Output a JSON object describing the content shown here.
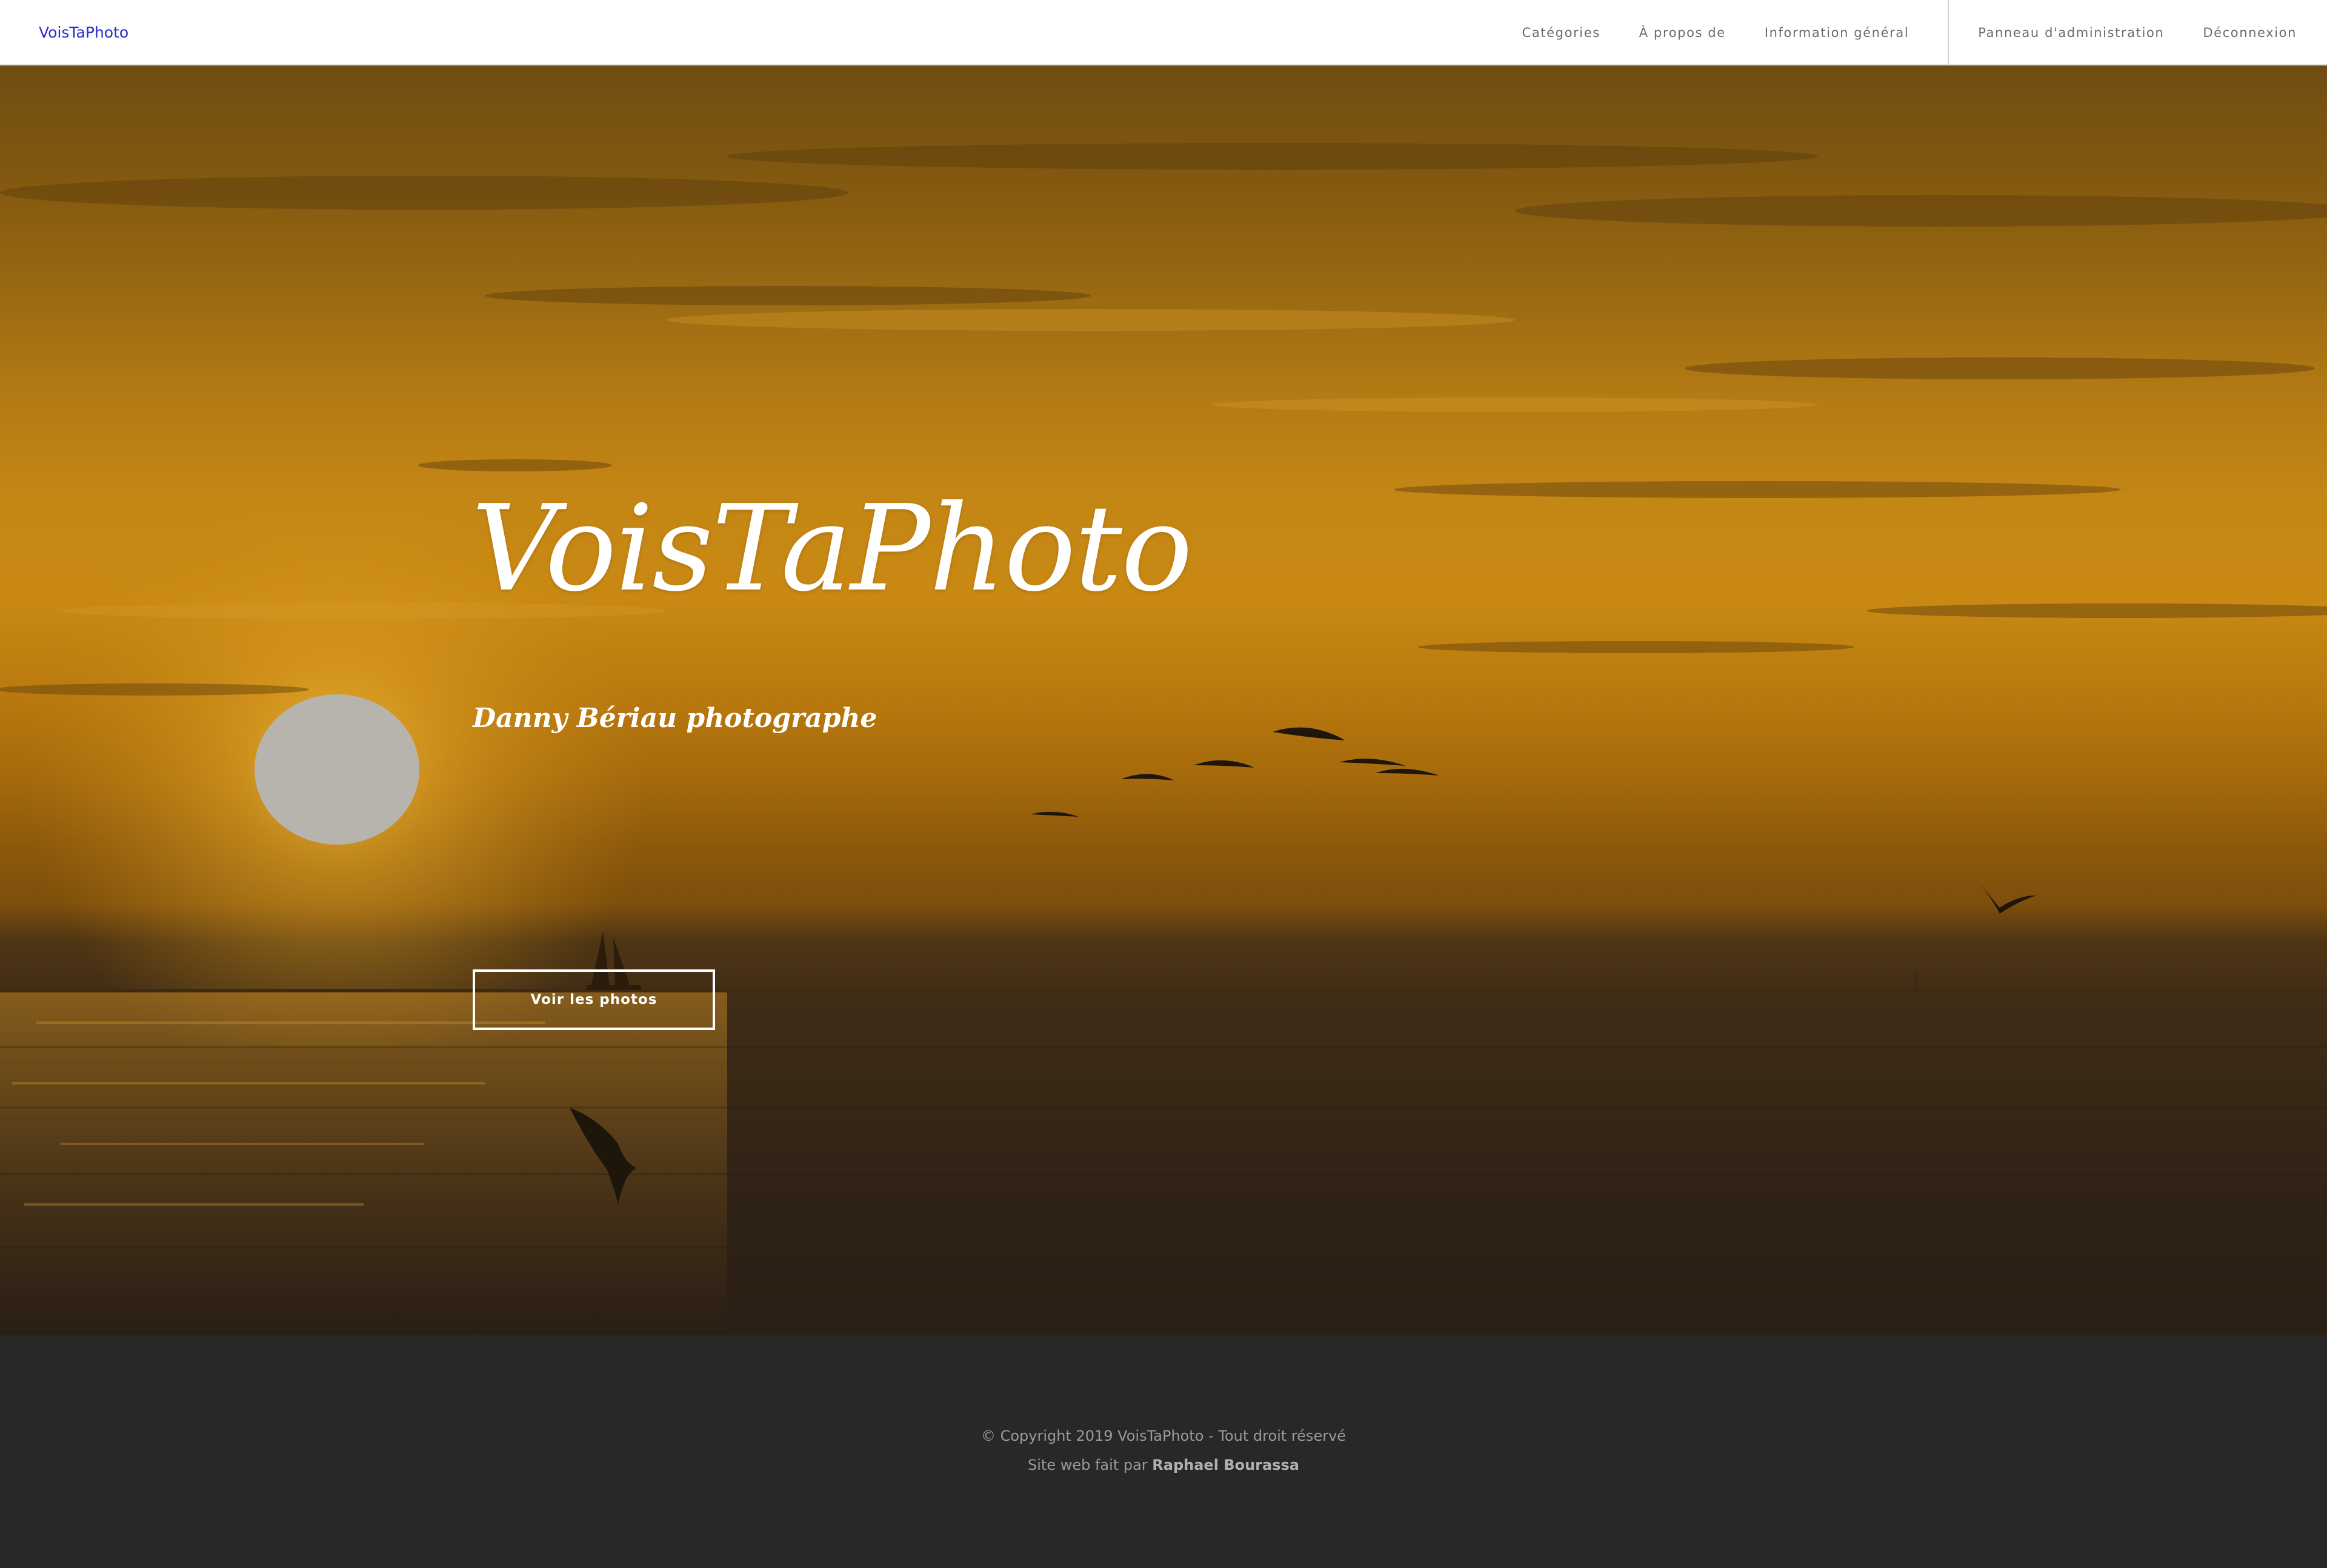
{
  "navbar": {
    "brand": "VoisTaPhoto",
    "links": [
      "Catégories",
      "À propos de",
      "Information général"
    ],
    "account_links": [
      "Panneau d'administration",
      "Déconnexion"
    ]
  },
  "hero": {
    "title": "VoisTaPhoto",
    "subtitle": "Danny Bériau photographe",
    "button_label": "Voir les photos",
    "image_description_icon": "sunset-sea-image"
  },
  "footer": {
    "copyright": "© Copyright 2019 VoisTaPhoto - Tout droit réservé",
    "credit_prefix": "Site web fait par",
    "credit_author": "Raphael Bourassa"
  },
  "colors": {
    "brand": "#2a2ad0",
    "footer_bg": "#282828",
    "sky_orange": "#c48614"
  }
}
